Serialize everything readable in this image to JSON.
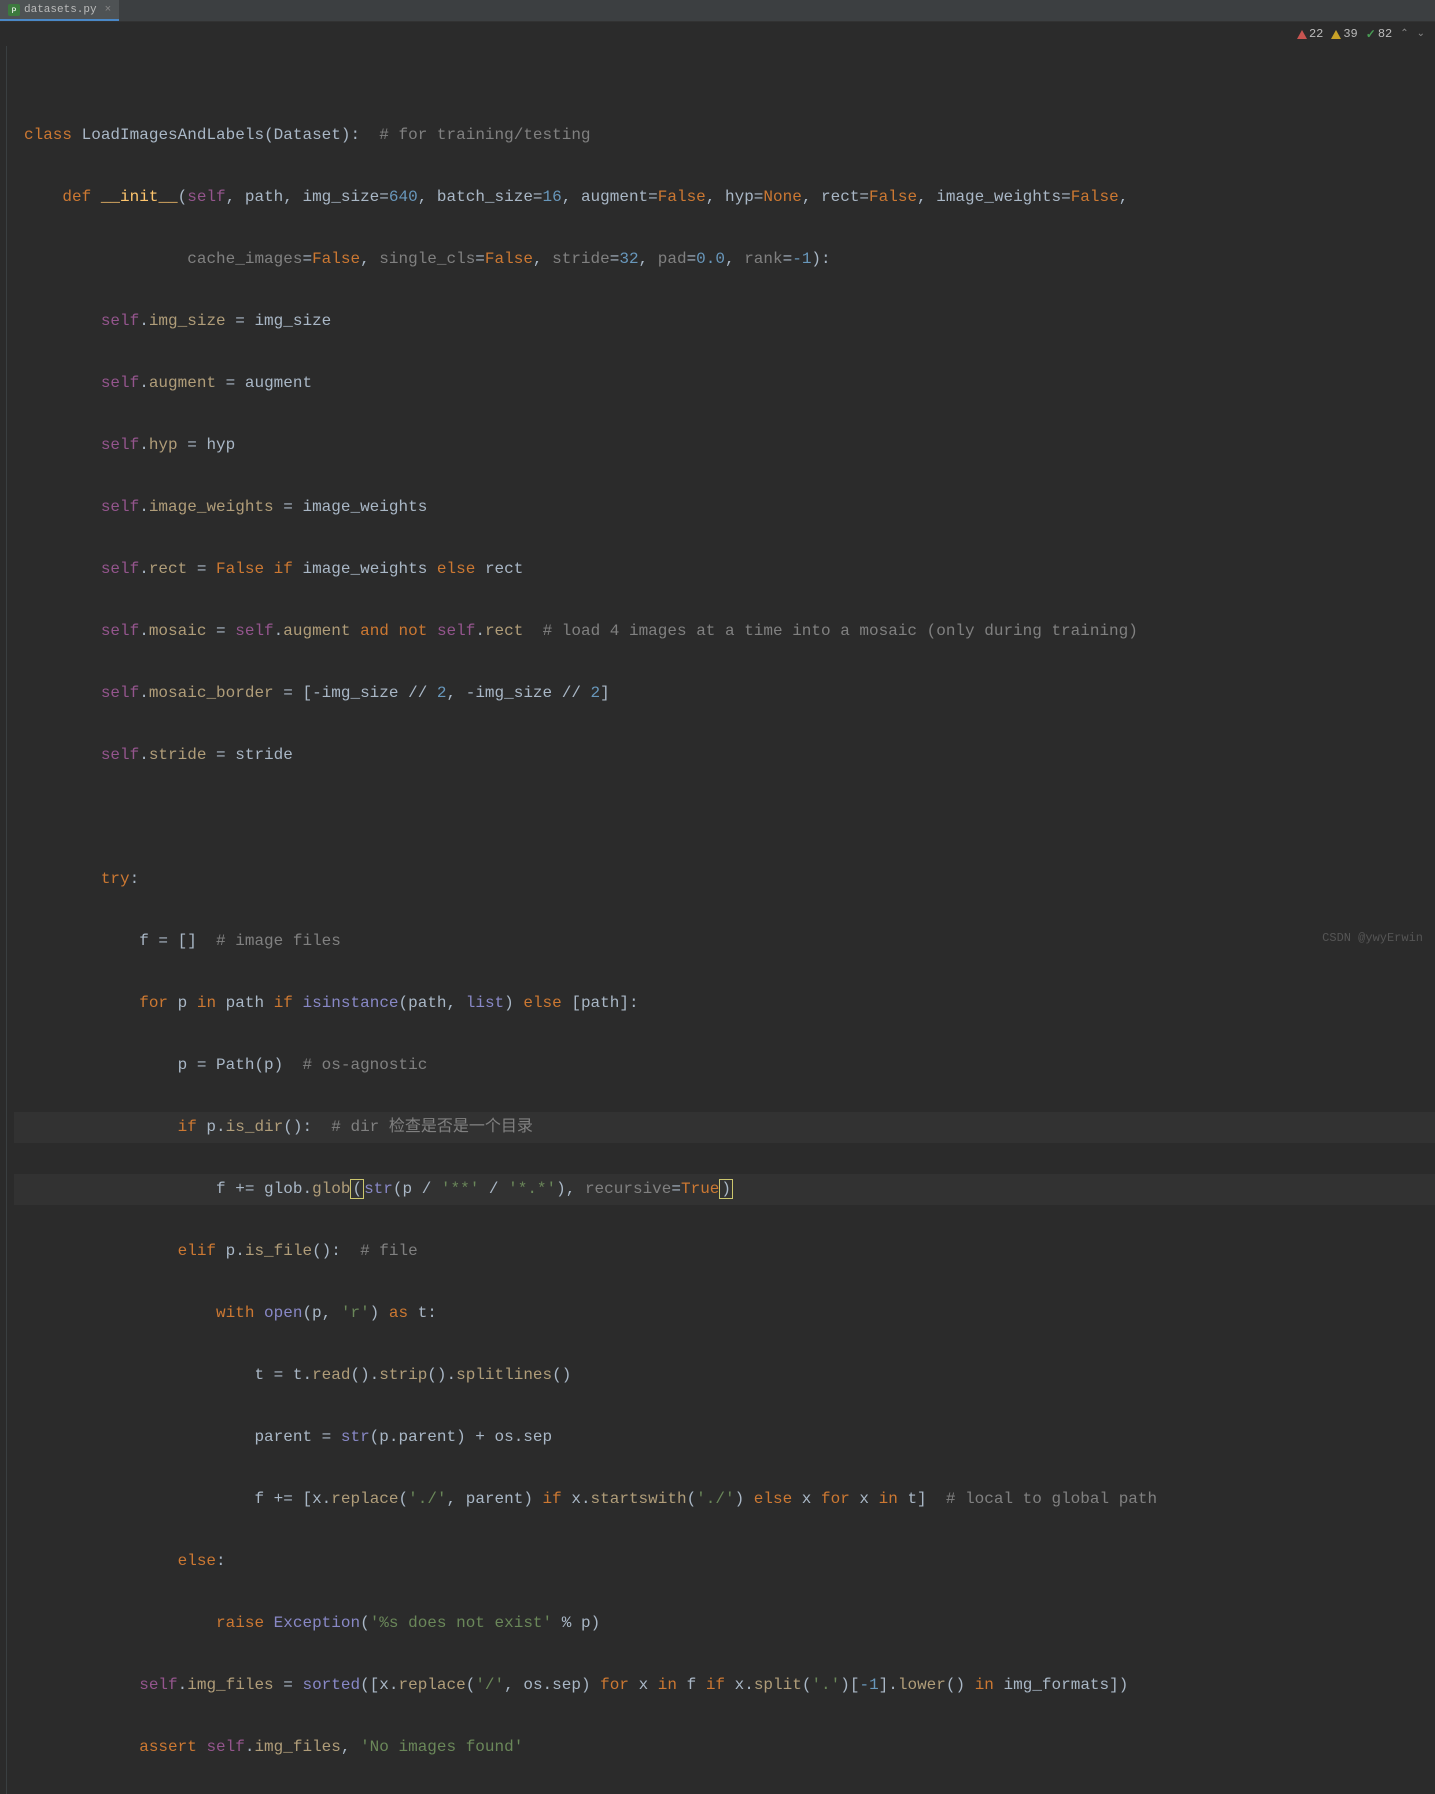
{
  "tab": {
    "filename": "datasets.py"
  },
  "status": {
    "errors": "22",
    "warnings": "39",
    "ok": "82"
  },
  "watermark": "CSDN @ywyErwin",
  "code": {
    "l1_kw_class": "class",
    "l1_cls": "LoadImagesAndLabels",
    "l1_base": "Dataset",
    "l1_cmt": "# for training/testing",
    "l2_kw_def": "def",
    "l2_fn": "__init__",
    "l2_self": "self",
    "l2_p_path": "path",
    "l2_p_img_size": "img_size",
    "l2_v_640": "640",
    "l2_p_batch_size": "batch_size",
    "l2_v_16": "16",
    "l2_p_augment": "augment",
    "l2_false": "False",
    "l2_p_hyp": "hyp",
    "l2_none": "None",
    "l2_p_rect": "rect",
    "l2_p_iw": "image_weights",
    "l3_p_cache": "cache_images",
    "l3_p_single": "single_cls",
    "l3_p_stride": "stride",
    "l3_v_32": "32",
    "l3_p_pad": "pad",
    "l3_v_00": "0.0",
    "l3_p_rank": "rank",
    "l3_v_neg1": "-1",
    "l4_attr": "img_size",
    "l4_rhs": "img_size",
    "l5_attr": "augment",
    "l5_rhs": "augment",
    "l6_attr": "hyp",
    "l6_rhs": "hyp",
    "l7_attr": "image_weights",
    "l7_rhs": "image_weights",
    "l8_attr": "rect",
    "l8_if": "if",
    "l8_iw": "image_weights",
    "l8_else": "else",
    "l8_rect": "rect",
    "l9_attr": "mosaic",
    "l9_aug": "augment",
    "l9_and": "and",
    "l9_not": "not",
    "l9_rect": "rect",
    "l9_cmt": "# load 4 images at a time into a mosaic (only during training)",
    "l10_attr": "mosaic_border",
    "l10_img": "img_size",
    "l10_two": "2",
    "l11_attr": "stride",
    "l11_rhs": "stride",
    "l12_try": "try",
    "l13_f": "f",
    "l13_cmt": "# image files",
    "l14_for": "for",
    "l14_p": "p",
    "l14_in": "in",
    "l14_path": "path",
    "l14_if": "if",
    "l14_isinstance": "isinstance",
    "l14_list": "list",
    "l14_else": "else",
    "l15_p": "p",
    "l15_Path": "Path",
    "l15_cmt": "# os-agnostic",
    "l16_if": "if",
    "l16_isdir": "is_dir",
    "l16_cmt": "# dir 检查是否是一个目录",
    "l17_f": "f",
    "l17_glob": "glob",
    "l17_str": "str",
    "l17_ss": "'**'",
    "l17_sa": "'*.*'",
    "l17_rec": "recursive",
    "l17_true": "True",
    "l18_elif": "elif",
    "l18_isfile": "is_file",
    "l18_cmt": "# file",
    "l19_with": "with",
    "l19_open": "open",
    "l19_r": "'r'",
    "l19_as": "as",
    "l19_t": "t",
    "l20_t": "t",
    "l20_read": "read",
    "l20_strip": "strip",
    "l20_split": "splitlines",
    "l21_parent": "parent",
    "l21_str": "str",
    "l21_pparent": "p.parent",
    "l21_os": "os.sep",
    "l22_f": "f",
    "l22_x": "x",
    "l22_replace": "replace",
    "l22_ds": "'./'",
    "l22_parent": "parent",
    "l22_if": "if",
    "l22_sw": "startswith",
    "l22_else": "else",
    "l22_for": "for",
    "l22_in": "in",
    "l22_t": "t",
    "l22_cmt": "# local to global path",
    "l23_else": "else",
    "l24_raise": "raise",
    "l24_exc": "Exception",
    "l24_str": "'%s does not exist'",
    "l24_pct": "%",
    "l24_p": "p",
    "l25_attr": "img_files",
    "l25_sorted": "sorted",
    "l25_x": "x",
    "l25_replace": "replace",
    "l25_slash": "'/'",
    "l25_os": "os.sep",
    "l25_for": "for",
    "l25_in": "in",
    "l25_f": "f",
    "l25_if": "if",
    "l25_split": "split",
    "l25_dot": "'.'",
    "l25_neg1": "-1",
    "l25_lower": "lower",
    "l25_fmt": "img_formats",
    "l26_assert": "assert",
    "l26_attr": "img_files",
    "l26_str": "'No images found'"
  }
}
